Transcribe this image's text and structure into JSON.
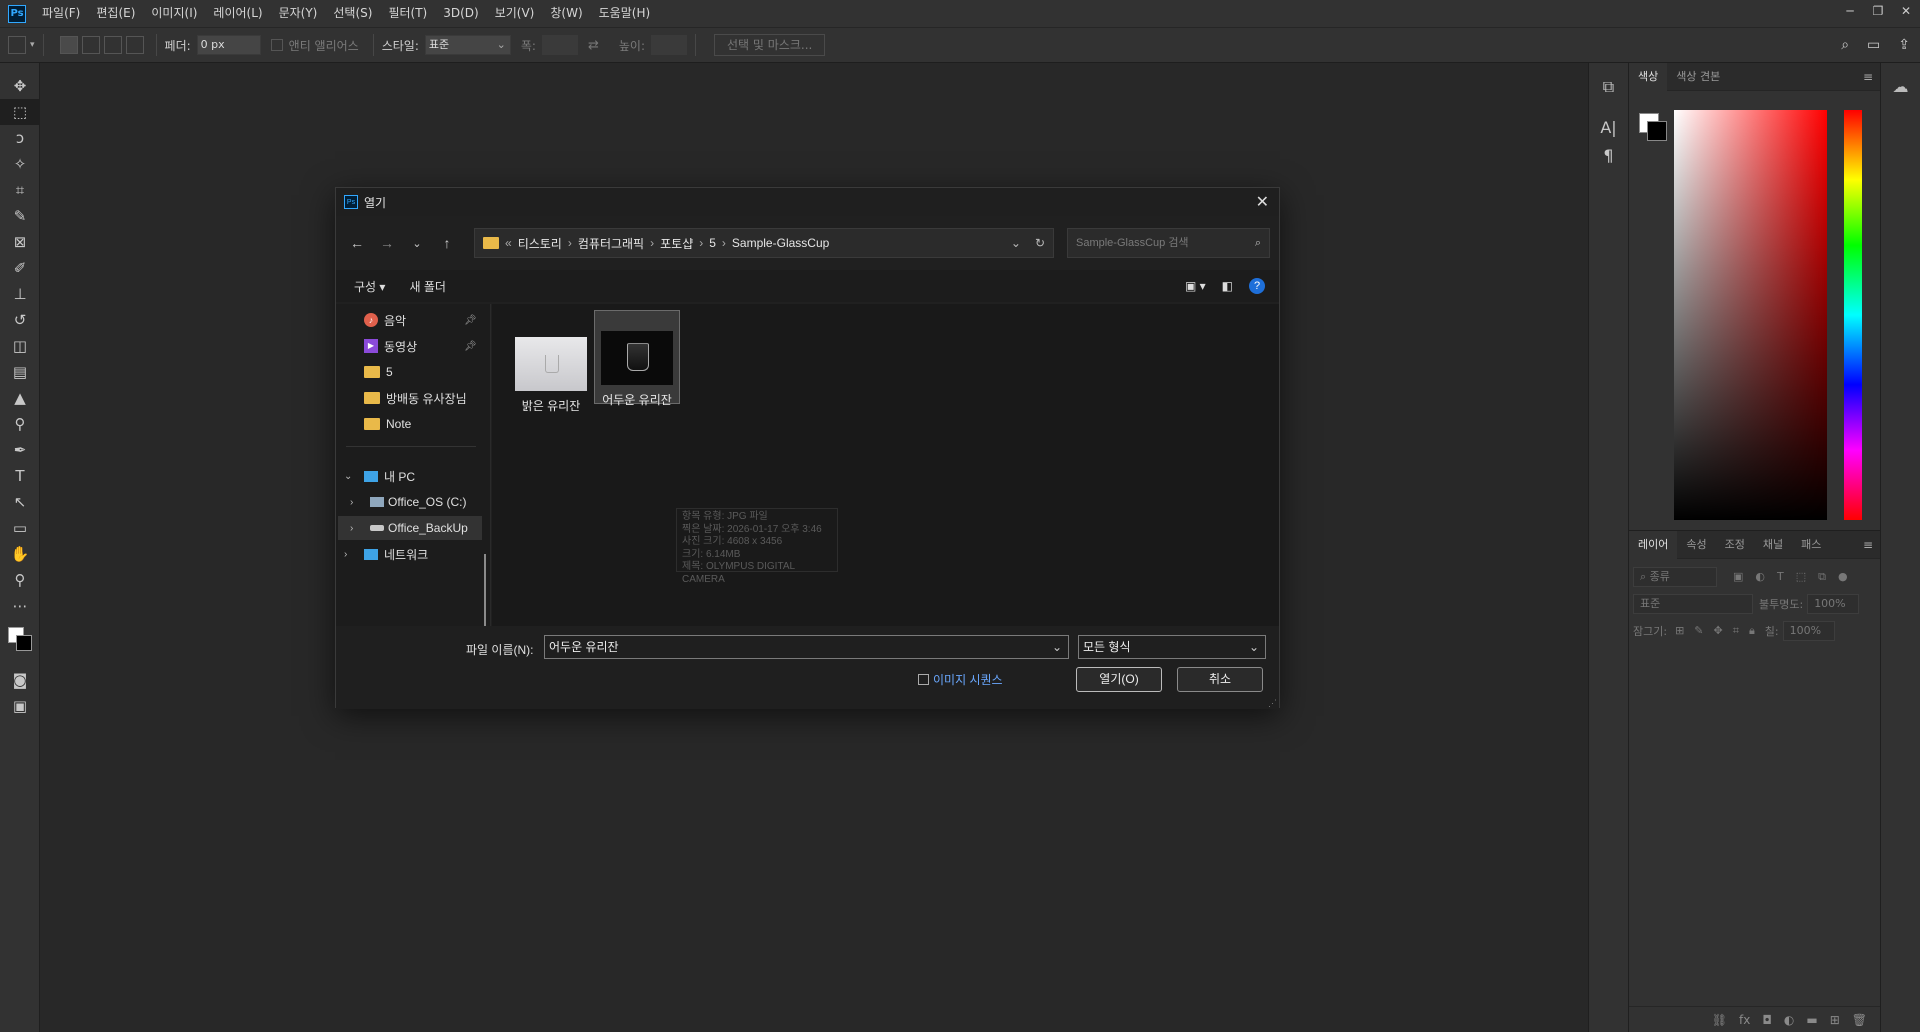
{
  "app": {
    "logo": "Ps"
  },
  "menu": [
    "파일(F)",
    "편집(E)",
    "이미지(I)",
    "레이어(L)",
    "문자(Y)",
    "선택(S)",
    "필터(T)",
    "3D(D)",
    "보기(V)",
    "창(W)",
    "도움말(H)"
  ],
  "window_controls": {
    "minimize": "─",
    "restore": "❐",
    "close": "✕"
  },
  "options": {
    "feather_label": "페더:",
    "feather_value": "0 px",
    "antialias_label": "앤티 앨리어스",
    "style_label": "스타일:",
    "style_value": "표준",
    "width_label": "폭:",
    "height_label": "높이:",
    "select_mask_label": "선택 및 마스크..."
  },
  "panels": {
    "color_tabs": [
      "색상",
      "색상 견본"
    ],
    "layer_tabs": [
      "레이어",
      "속성",
      "조정",
      "채널",
      "패스"
    ],
    "layer_filter": "종류",
    "blend_mode": "표준",
    "opacity_label": "불투명도:",
    "opacity_value": "100%",
    "lock_label": "잠그기:",
    "fill_label": "칠:",
    "fill_value": "100%"
  },
  "dialog": {
    "title": "열기",
    "breadcrumb": [
      "«",
      "티스토리",
      "컴퓨터그래픽",
      "포토샵",
      "5",
      "Sample-GlassCup"
    ],
    "search_placeholder": "Sample-GlassCup 검색",
    "commands": {
      "organize": "구성 ▾",
      "new_folder": "새 폴더"
    },
    "nav_items": [
      "음악",
      "동영상",
      "5",
      "방배동 유사장님",
      "Note",
      "내 PC",
      "Office_OS (C:)",
      "Office_BackUp",
      "네트워크"
    ],
    "files": [
      {
        "name": "밝은 유리잔",
        "selected": false
      },
      {
        "name": "어두운 유리잔",
        "selected": true
      }
    ],
    "tooltip": [
      "항목 유형: JPG 파일",
      "찍은 날짜: 2026-01-17 오후 3:46",
      "사진 크기: 4608 x 3456",
      "크기: 6.14MB",
      "제목: OLYMPUS DIGITAL CAMERA"
    ],
    "filename_label": "파일 이름(N):",
    "filename_value": "어두운 유리잔",
    "filetype_value": "모든 형식",
    "image_sequence_label": "이미지 시퀀스",
    "open_button": "열기(O)",
    "cancel_button": "취소"
  }
}
